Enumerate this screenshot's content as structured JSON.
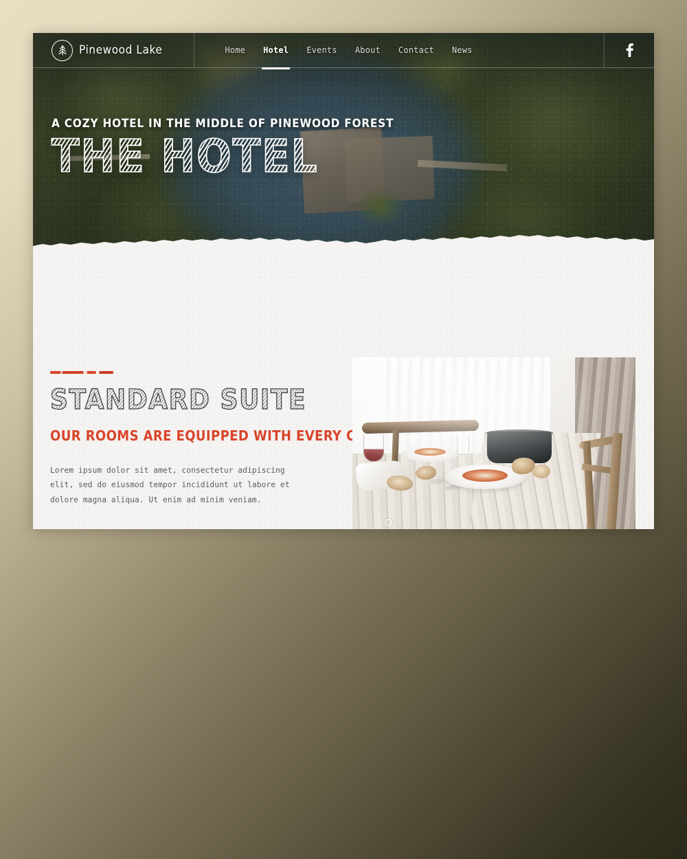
{
  "site": {
    "brand_name": "Pinewood Lake",
    "logo_icon": "pine-tree-icon"
  },
  "nav": {
    "items": [
      {
        "label": "Home",
        "active": false
      },
      {
        "label": "Hotel",
        "active": true
      },
      {
        "label": "Events",
        "active": false
      },
      {
        "label": "About",
        "active": false
      },
      {
        "label": "Contact",
        "active": false
      },
      {
        "label": "News",
        "active": false
      }
    ]
  },
  "social": {
    "facebook_icon": "facebook-icon",
    "facebook_label": "f"
  },
  "hero": {
    "kicker": "A COZY HOTEL IN THE MIDDLE OF PINEWOOD FOREST",
    "title": "THE HOTEL",
    "image_alt": "Aerial view of a manor house on an island in a forest lake"
  },
  "section": {
    "title": "STANDARD SUITE",
    "subtitle": "OUR ROOMS ARE EQUIPPED WITH EVERY COMFORT",
    "body": "Lorem ipsum dolor sit amet, consectetur adipiscing elit, sed do eiusmod tempor incididunt ut labore et dolore magna aliqua. Ut enim ad minim veniam.",
    "photo_alt": "Rustic wooden dining table set with bowls of soup, bread and wine",
    "photo_dot_icon": "gallery-dot-icon"
  },
  "colors": {
    "accent_red": "#d9452b",
    "content_bg": "#f4f3f1",
    "text_light": "#ffffff",
    "body_text": "#5b5b5b",
    "heading_dark": "#3a3a3a"
  }
}
